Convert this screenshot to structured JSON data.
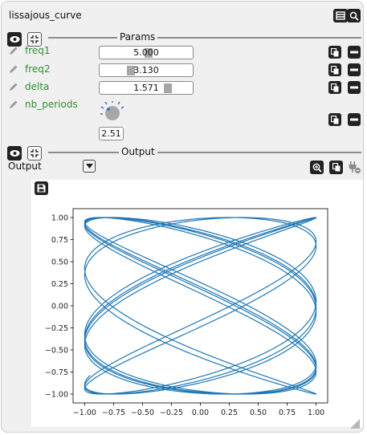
{
  "node": {
    "title": "lissajous_curve"
  },
  "params_section": {
    "label": "Params"
  },
  "params": [
    {
      "name": "freq1",
      "value": "5.000",
      "slider_fraction": 0.47
    },
    {
      "name": "freq2",
      "value": "3.130",
      "slider_fraction": 0.3
    },
    {
      "name": "delta",
      "value": "1.571",
      "slider_fraction": 0.72
    },
    {
      "name": "nb_periods",
      "value": "2.51"
    }
  ],
  "output_section": {
    "label": "Output",
    "field_label": "Output"
  },
  "chart_data": {
    "type": "line",
    "title": "",
    "xlabel": "",
    "ylabel": "",
    "xlim": [
      -1.1,
      1.1
    ],
    "ylim": [
      -1.1,
      1.1
    ],
    "xticks": [
      "−1.00",
      "−0.75",
      "−0.50",
      "−0.25",
      "0.00",
      "0.25",
      "0.50",
      "0.75",
      "1.00"
    ],
    "yticks": [
      "1.00",
      "0.75",
      "0.50",
      "0.25",
      "0.00",
      "−0.25",
      "−0.50",
      "−0.75",
      "−1.00"
    ],
    "series": [
      {
        "x": "sin(5.000 t + 1.571)",
        "y": "sin(3.130 t)",
        "t_range": [
          0,
          15.77
        ],
        "color": "#1f77b4"
      }
    ],
    "grid": false
  },
  "colors": {
    "accent": "#1f77b4",
    "param_label": "#2f8f2f",
    "knob_marker": "#2a6fd6"
  }
}
